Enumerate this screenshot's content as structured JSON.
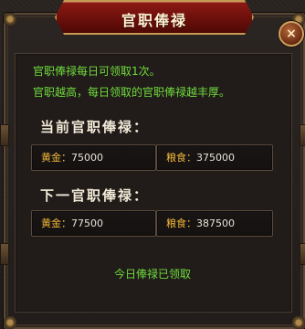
{
  "window": {
    "title": "官职俸禄",
    "close_label": "×"
  },
  "info": {
    "line1": "官职俸禄每日可领取1次。",
    "line2": "官职越高，每日领取的官职俸禄越丰厚。"
  },
  "current": {
    "heading": "当前官职俸禄：",
    "gold_label": "黄金：",
    "gold_value": "75000",
    "food_label": "粮食：",
    "food_value": "375000"
  },
  "next": {
    "heading": "下一官职俸禄：",
    "gold_label": "黄金：",
    "gold_value": "77500",
    "food_label": "粮食：",
    "food_value": "387500"
  },
  "status_text": "今日俸禄已领取",
  "colors": {
    "title_red": "#8e1a14",
    "trim_gold": "#c59a52",
    "info_green": "#6fdc3c",
    "label_gold": "#f0b73a"
  },
  "icons": [
    "close-icon"
  ]
}
